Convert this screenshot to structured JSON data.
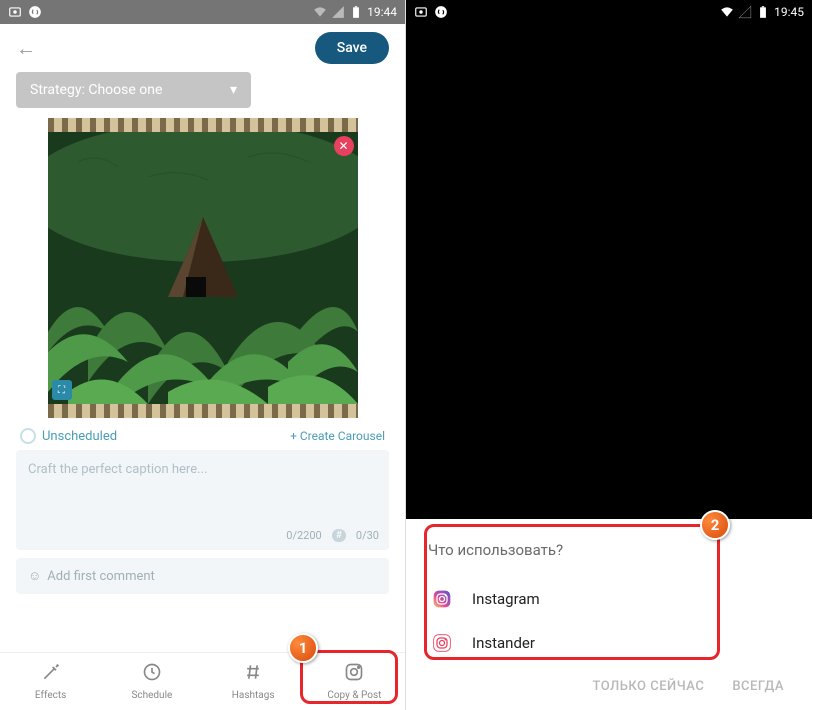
{
  "left": {
    "status": {
      "time": "19:44"
    },
    "header": {
      "save_label": "Save"
    },
    "strategy": {
      "label": "Strategy: Choose one"
    },
    "meta": {
      "unscheduled": "Unscheduled",
      "create_carousel": "+ Create Carousel"
    },
    "caption": {
      "placeholder": "Craft the perfect caption here...",
      "char_counter": "0/2200",
      "hash_counter": "0/30"
    },
    "comment": {
      "placeholder": "Add first comment"
    },
    "nav": {
      "effects": "Effects",
      "schedule": "Schedule",
      "hashtags": "Hashtags",
      "copy_post": "Copy & Post"
    }
  },
  "right": {
    "status": {
      "time": "19:45"
    },
    "dialog": {
      "title": "Что использовать?",
      "options": [
        {
          "label": "Instagram"
        },
        {
          "label": "Instander"
        }
      ],
      "action_once": "ТОЛЬКО СЕЙЧАС",
      "action_always": "ВСЕГДА"
    }
  },
  "badges": {
    "one": "1",
    "two": "2"
  }
}
